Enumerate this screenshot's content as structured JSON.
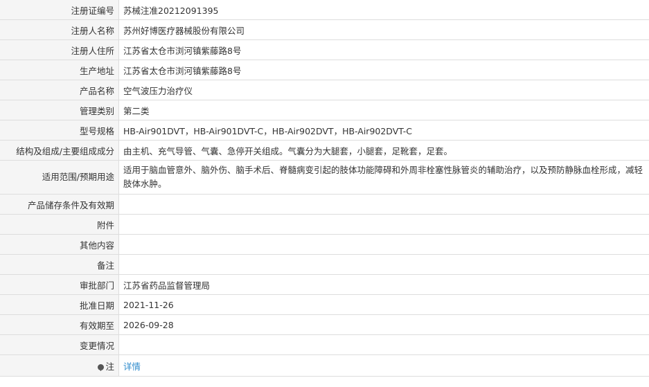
{
  "rows": [
    {
      "label": "注册证编号",
      "value": "苏械注准20212091395"
    },
    {
      "label": "注册人名称",
      "value": "苏州好博医疗器械股份有限公司"
    },
    {
      "label": "注册人住所",
      "value": "江苏省太仓市浏河镇紫藤路8号"
    },
    {
      "label": "生产地址",
      "value": "江苏省太仓市浏河镇紫藤路8号"
    },
    {
      "label": "产品名称",
      "value": "空气波压力治疗仪"
    },
    {
      "label": "管理类别",
      "value": "第二类"
    },
    {
      "label": "型号规格",
      "value": "HB-Air901DVT，HB-Air901DVT-C，HB-Air902DVT，HB-Air902DVT-C"
    },
    {
      "label": "结构及组成/主要组成成分",
      "value": "由主机、充气导管、气囊、急停开关组成。气囊分为大腿套，小腿套，足靴套，足套。"
    },
    {
      "label": "适用范围/预期用途",
      "value": "适用于脑血管意外、脑外伤、脑手术后、脊髓病变引起的肢体功能障碍和外周非栓塞性脉管炎的辅助治疗，以及预防静脉血栓形成，减轻肢体水肿。"
    },
    {
      "label": "产品储存条件及有效期",
      "value": ""
    },
    {
      "label": "附件",
      "value": ""
    },
    {
      "label": "其他内容",
      "value": ""
    },
    {
      "label": "备注",
      "value": ""
    },
    {
      "label": "审批部门",
      "value": "江苏省药品监督管理局"
    },
    {
      "label": "批准日期",
      "value": "2021-11-26"
    },
    {
      "label": "有效期至",
      "value": "2026-09-28"
    },
    {
      "label": "变更情况",
      "value": ""
    }
  ],
  "note": {
    "icon": "note-pin-icon",
    "label": "注",
    "link": "详情"
  },
  "colors": {
    "label_bg": "#f5f5f5",
    "border": "#dddddd",
    "link": "#2e8bcc"
  }
}
